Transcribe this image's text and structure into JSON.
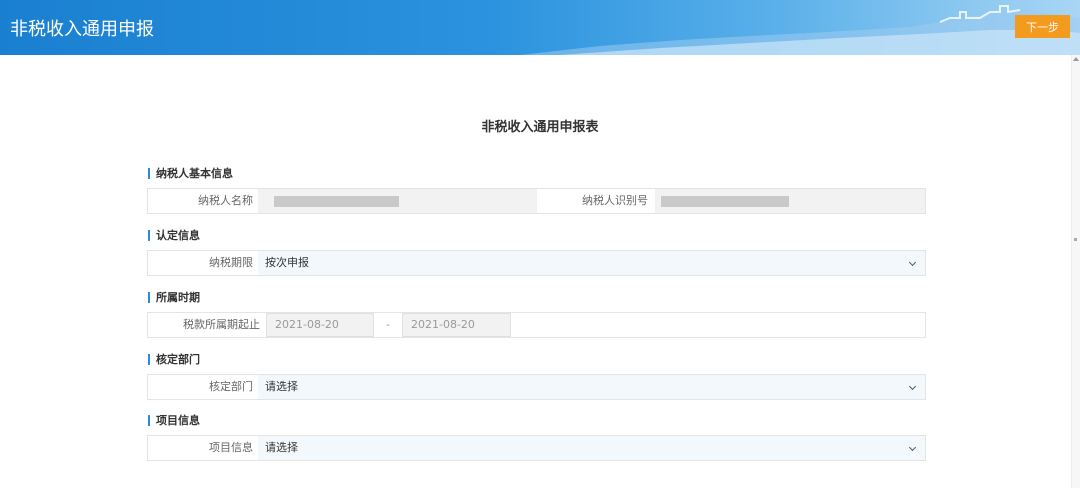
{
  "header": {
    "title": "非税收入通用申报",
    "next_label": "下一步",
    "colors": {
      "bar": "#2a92de",
      "button": "#f39b1f"
    }
  },
  "form": {
    "title": "非税收入通用申报表",
    "taxpayer": {
      "section": "纳税人基本信息",
      "name_label": "纳税人名称",
      "id_label": "纳税人识别号"
    },
    "identification": {
      "section": "认定信息",
      "period_label": "纳税期限",
      "period_value": "按次申报"
    },
    "period": {
      "section": "所属时期",
      "label": "税款所属期起止",
      "start": "2021-08-20",
      "separator": "-",
      "end": "2021-08-20"
    },
    "department": {
      "section": "核定部门",
      "label": "核定部门",
      "value": "请选择"
    },
    "project": {
      "section": "项目信息",
      "label": "项目信息",
      "value": "请选择"
    }
  }
}
